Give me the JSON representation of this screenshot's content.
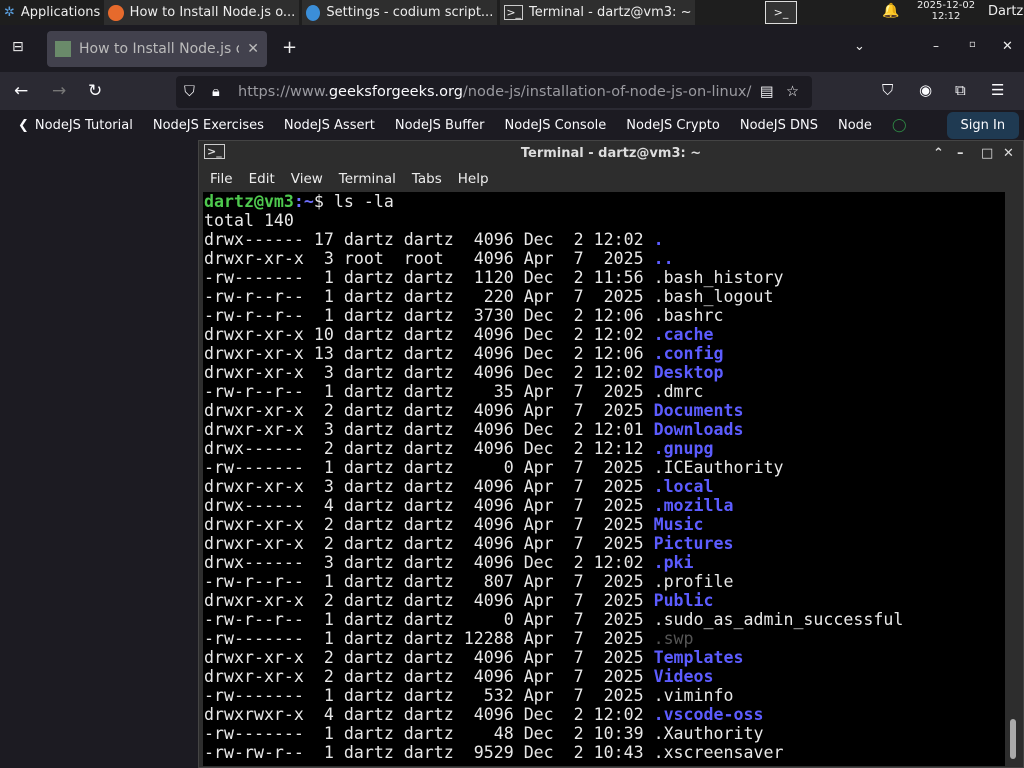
{
  "taskbar": {
    "apps_label": "Applications",
    "windows": [
      {
        "title": "How to Install Node.js o...",
        "icon": "firefox-icon"
      },
      {
        "title": "Settings - codium script...",
        "icon": "codium-icon"
      },
      {
        "title": "Terminal - dartz@vm3: ~",
        "icon": "terminal-icon"
      }
    ],
    "date": "2025-12-02",
    "time": "12:12",
    "user": "Dartz"
  },
  "browser": {
    "tab_title": "How to Install Node.js or",
    "url_pre": "https://www.",
    "url_domain": "geeksforgeeks.org",
    "url_path": "/node-js/installation-of-node-js-on-linux/",
    "bookmarks": [
      "NodeJS Tutorial",
      "NodeJS Exercises",
      "NodeJS Assert",
      "NodeJS Buffer",
      "NodeJS Console",
      "NodeJS Crypto",
      "NodeJS DNS",
      "Node"
    ],
    "sign_in": "Sign In"
  },
  "terminal": {
    "title": "Terminal - dartz@vm3: ~",
    "menu": [
      "File",
      "Edit",
      "View",
      "Terminal",
      "Tabs",
      "Help"
    ],
    "prompt_user": "dartz@vm3",
    "prompt_path": ":~",
    "prompt_symbol": "$ ",
    "command": "ls -la",
    "total": "total 140",
    "rows": [
      {
        "meta": "drwx------ 17 dartz dartz  4096 Dec  2 12:02 ",
        "name": ".",
        "type": "dir"
      },
      {
        "meta": "drwxr-xr-x  3 root  root   4096 Apr  7  2025 ",
        "name": "..",
        "type": "dir"
      },
      {
        "meta": "-rw-------  1 dartz dartz  1120 Dec  2 11:56 ",
        "name": ".bash_history",
        "type": "file"
      },
      {
        "meta": "-rw-r--r--  1 dartz dartz   220 Apr  7  2025 ",
        "name": ".bash_logout",
        "type": "file"
      },
      {
        "meta": "-rw-r--r--  1 dartz dartz  3730 Dec  2 12:06 ",
        "name": ".bashrc",
        "type": "file"
      },
      {
        "meta": "drwxr-xr-x 10 dartz dartz  4096 Dec  2 12:02 ",
        "name": ".cache",
        "type": "dir"
      },
      {
        "meta": "drwxr-xr-x 13 dartz dartz  4096 Dec  2 12:06 ",
        "name": ".config",
        "type": "dir"
      },
      {
        "meta": "drwxr-xr-x  3 dartz dartz  4096 Dec  2 12:02 ",
        "name": "Desktop",
        "type": "dir"
      },
      {
        "meta": "-rw-r--r--  1 dartz dartz    35 Apr  7  2025 ",
        "name": ".dmrc",
        "type": "file"
      },
      {
        "meta": "drwxr-xr-x  2 dartz dartz  4096 Apr  7  2025 ",
        "name": "Documents",
        "type": "dir"
      },
      {
        "meta": "drwxr-xr-x  3 dartz dartz  4096 Dec  2 12:01 ",
        "name": "Downloads",
        "type": "dir"
      },
      {
        "meta": "drwx------  2 dartz dartz  4096 Dec  2 12:12 ",
        "name": ".gnupg",
        "type": "dir"
      },
      {
        "meta": "-rw-------  1 dartz dartz     0 Apr  7  2025 ",
        "name": ".ICEauthority",
        "type": "file"
      },
      {
        "meta": "drwxr-xr-x  3 dartz dartz  4096 Apr  7  2025 ",
        "name": ".local",
        "type": "dir"
      },
      {
        "meta": "drwx------  4 dartz dartz  4096 Apr  7  2025 ",
        "name": ".mozilla",
        "type": "dir"
      },
      {
        "meta": "drwxr-xr-x  2 dartz dartz  4096 Apr  7  2025 ",
        "name": "Music",
        "type": "dir"
      },
      {
        "meta": "drwxr-xr-x  2 dartz dartz  4096 Apr  7  2025 ",
        "name": "Pictures",
        "type": "dir"
      },
      {
        "meta": "drwx------  3 dartz dartz  4096 Dec  2 12:02 ",
        "name": ".pki",
        "type": "dir"
      },
      {
        "meta": "-rw-r--r--  1 dartz dartz   807 Apr  7  2025 ",
        "name": ".profile",
        "type": "file"
      },
      {
        "meta": "drwxr-xr-x  2 dartz dartz  4096 Apr  7  2025 ",
        "name": "Public",
        "type": "dir"
      },
      {
        "meta": "-rw-r--r--  1 dartz dartz     0 Apr  7  2025 ",
        "name": ".sudo_as_admin_successful",
        "type": "file"
      },
      {
        "meta": "-rw-------  1 dartz dartz 12288 Apr  7  2025 ",
        "name": ".swp",
        "type": "dim"
      },
      {
        "meta": "drwxr-xr-x  2 dartz dartz  4096 Apr  7  2025 ",
        "name": "Templates",
        "type": "dir"
      },
      {
        "meta": "drwxr-xr-x  2 dartz dartz  4096 Apr  7  2025 ",
        "name": "Videos",
        "type": "dir"
      },
      {
        "meta": "-rw-------  1 dartz dartz   532 Apr  7  2025 ",
        "name": ".viminfo",
        "type": "file"
      },
      {
        "meta": "drwxrwxr-x  4 dartz dartz  4096 Dec  2 12:02 ",
        "name": ".vscode-oss",
        "type": "dir"
      },
      {
        "meta": "-rw-------  1 dartz dartz    48 Dec  2 10:39 ",
        "name": ".Xauthority",
        "type": "file"
      },
      {
        "meta": "-rw-rw-r--  1 dartz dartz  9529 Dec  2 10:43 ",
        "name": ".xscreensaver",
        "type": "file"
      }
    ]
  },
  "colors": {
    "directory": "#5c5cff",
    "prompt_user": "#4ec94e",
    "terminal_bg": "#000000"
  }
}
